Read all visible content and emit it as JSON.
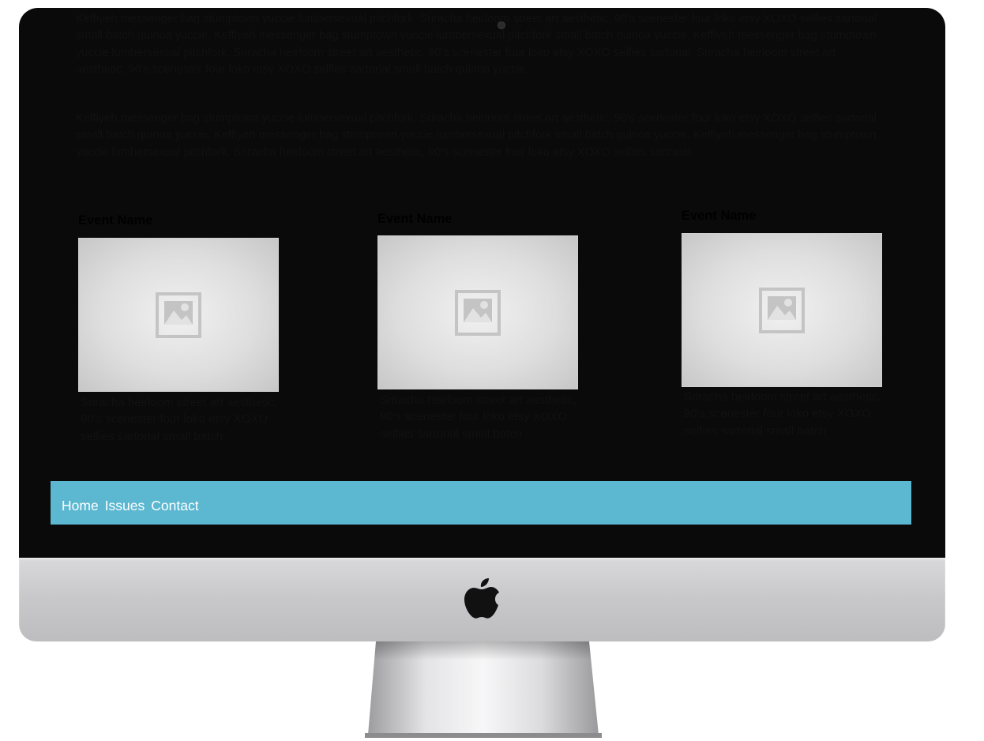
{
  "page": {
    "paragraph_1_visible": "Keffiyeh messenger bag stumptown yuccie lumbersexual pitchfork. Sriracha heirloom street art aesthetic, 90's scenester four loko etsy XOXO selfies sartorial small batch quinoa yuccie. Keffiyeh messenger bag stumptown yuccie lumbersexual pitchfork small batch quinoa yuccie. Keffiyeh messenger bag stumptown yuccie lumbersexual pitchfork. Sriracha heirloom street art aesthetic, 90's scenester four loko etsy XOXO selfies sartorial. Sriracha heirloom street art aesthetic, 90's scenester four loko etsy XOXO selfies sartorial small batch quinoa yuccie.",
    "paragraph_2": " Keffiyeh messenger bag stumptown yuccie lumbersexual pitchfork. Sriracha heirloom street art aesthetic, 90's scenester four loko etsy XOXO selfies sartorial small batch quinoa yuccie. Keffiyeh messenger bag stumptown yuccie lumbersexual pitchfork small batch quinoa yuccie. Keffiyeh messenger bag stumptown yuccie lumbersexual pitchfork. Sriracha heirloom street art aesthetic, 90's scenester four loko etsy XOXO selfies sartorial."
  },
  "events": [
    {
      "title": "Event Name",
      "image_icon": "image-placeholder-icon",
      "description": "Sriracha heirloom street art aesthetic, 90's scenester four loko etsy XOXO selfies sartorial small batch"
    },
    {
      "title": "Event Name",
      "image_icon": "image-placeholder-icon",
      "description": "Sriracha heirloom street art aesthetic, 90's scenester four loko etsy XOXO selfies sartorial small batch"
    },
    {
      "title": "Event Name",
      "image_icon": "image-placeholder-icon",
      "description": "Sriracha heirloom street art aesthetic, 90's scenester four loko etsy XOXO selfies sartorial small batch"
    }
  ],
  "nav": {
    "home": "Home",
    "issues": "Issues",
    "contact": "Contact"
  },
  "colors": {
    "nav_bar": "#5cb8d1",
    "bezel": "#0a0a0a",
    "chin": "#cfcfd2"
  },
  "device": {
    "logo_icon": "apple-logo-icon"
  }
}
